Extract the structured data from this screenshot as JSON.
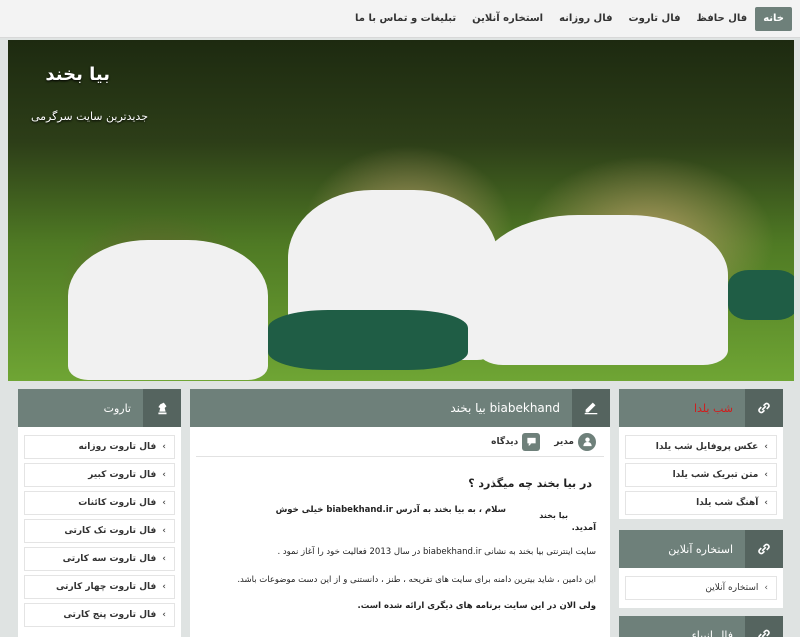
{
  "nav": {
    "items": [
      "خانه",
      "فال حافظ",
      "فال تاروت",
      "فال روزانه",
      "استخاره آنلاین",
      "تبلیغات و تماس با ما"
    ]
  },
  "hero": {
    "title": "بیا بخند",
    "subtitle": "جدیدترین سایت سرگرمی"
  },
  "tarot_panel": {
    "title": "تاروت",
    "items": [
      "فال تاروت روزانه",
      "فال تاروت کبیر",
      "فال تاروت کائنات",
      "فال تاروت تک کارتی",
      "فال تاروت سه کارتی",
      "فال تاروت چهار کارتی",
      "فال تاروت پنج کارتی"
    ]
  },
  "main": {
    "title": "بیا بخند biabekhand",
    "author_label": "مدیر",
    "views_label": "دیدگاه",
    "post_title": "در بیا بخند چه میگذرد ؟",
    "lines": [
      "سلام ، به بیا بخند به آدرس biabekhand.ir خیلی خوش",
      "آمدید.",
      "سایت اینترنتی بیا بخند به نشانی biabekhand.ir در سال 2013 فعالیت خود را آغاز نمود .",
      "این دامین ، شاید بیترین دامنه برای سایت های تفریحه ، طنز ، دانستنی و از این دست موضوعات باشد.",
      "ولی الان در این سایت برنامه های دیگری ارائه شده است."
    ],
    "inline_brand": "بیا بخند"
  },
  "yalda_panel": {
    "title": "شب یلدا",
    "title_color": "#d21b1b",
    "items": [
      "عکس پروفایل شب یلدا",
      "متن تبریک شب یلدا",
      "آهنگ شب یلدا"
    ]
  },
  "istikhara_panel": {
    "title": "استخاره آنلاین",
    "items": [
      "استخاره آنلاین"
    ]
  },
  "bottom_panel": {
    "title": "فال انبیاء"
  },
  "colors": {
    "header": "#6e807a",
    "header_dark": "#55645f",
    "accent_red": "#d21b1b"
  },
  "icons": {
    "panel": "link-icon",
    "main": "edit-icon",
    "tarot": "chess-knight-icon",
    "author": "user-icon",
    "views": "comment-icon"
  }
}
